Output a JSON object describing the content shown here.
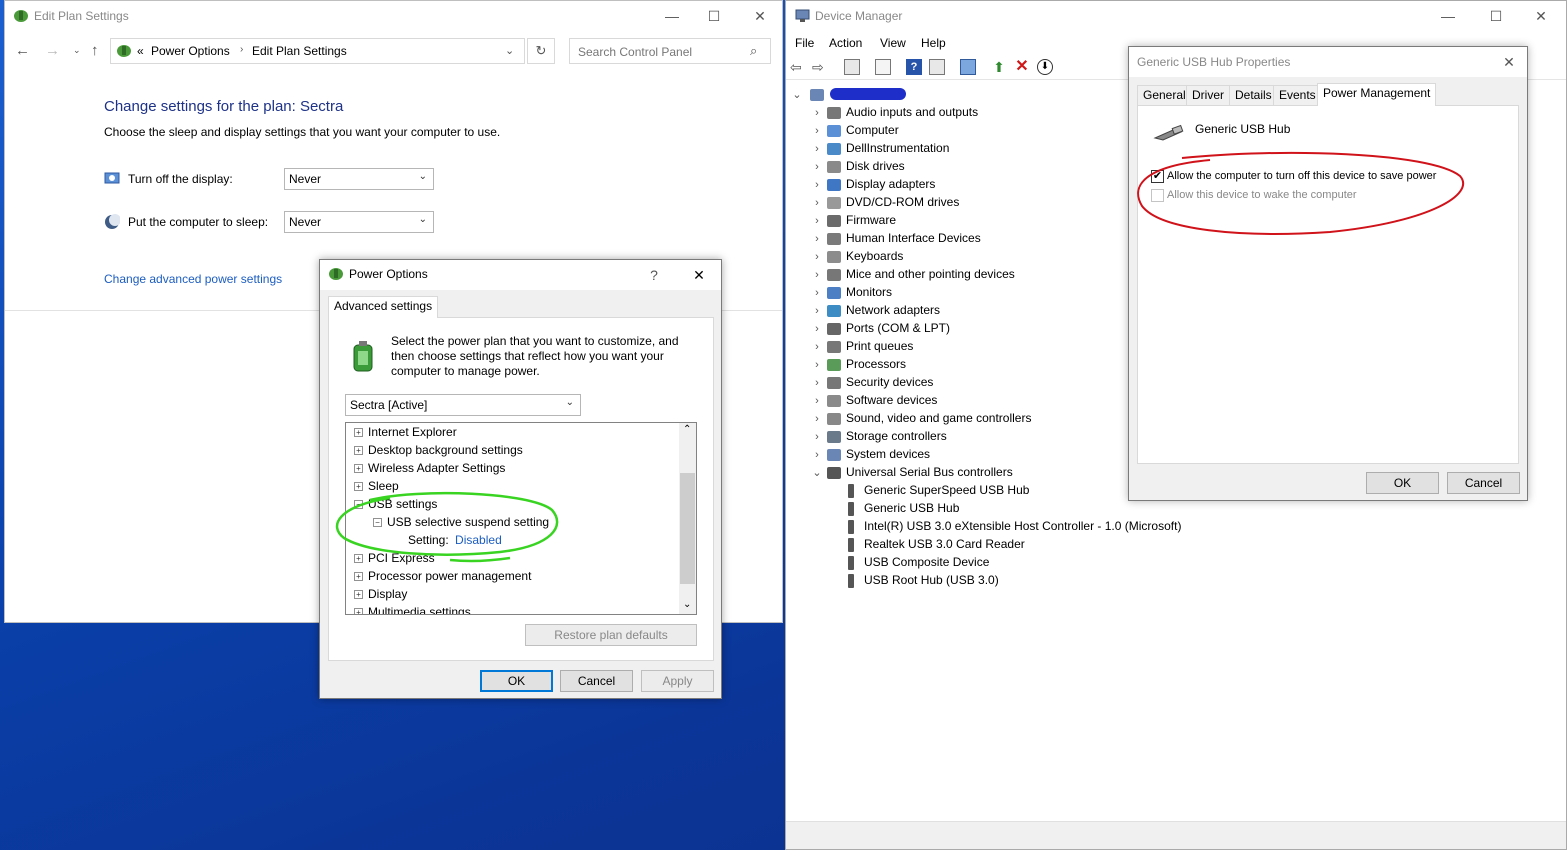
{
  "edit_plan": {
    "title": "Edit Plan Settings",
    "breadcrumb_prefix": "«",
    "breadcrumb": [
      "Power Options",
      "Edit Plan Settings"
    ],
    "search_placeholder": "Search Control Panel",
    "heading": "Change settings for the plan: Sectra",
    "subheading": "Choose the sleep and display settings that you want your computer to use.",
    "display_label": "Turn off the display:",
    "display_value": "Never",
    "sleep_label": "Put the computer to sleep:",
    "sleep_value": "Never",
    "advanced_link": "Change advanced power settings"
  },
  "power_options": {
    "title": "Power Options",
    "help": "?",
    "tab": "Advanced settings",
    "description": "Select the power plan that you want to customize, and then choose settings that reflect how you want your computer to manage power.",
    "plan": "Sectra [Active]",
    "tree": [
      {
        "label": "Internet Explorer",
        "sign": "+"
      },
      {
        "label": "Desktop background settings",
        "sign": "+"
      },
      {
        "label": "Wireless Adapter Settings",
        "sign": "+"
      },
      {
        "label": "Sleep",
        "sign": "+"
      },
      {
        "label": "USB settings",
        "sign": "−"
      },
      {
        "label": "USB selective suspend setting",
        "sign": "−"
      },
      {
        "label": "PCI Express",
        "sign": "+"
      },
      {
        "label": "Processor power management",
        "sign": "+"
      },
      {
        "label": "Display",
        "sign": "+"
      },
      {
        "label": "Multimedia settings",
        "sign": "+"
      }
    ],
    "setting_label": "Setting:",
    "setting_value": "Disabled",
    "restore": "Restore plan defaults",
    "ok": "OK",
    "cancel": "Cancel",
    "apply": "Apply"
  },
  "device_manager": {
    "title": "Device Manager",
    "menu": [
      "File",
      "Action",
      "View",
      "Help"
    ],
    "categories": [
      "Audio inputs and outputs",
      "Computer",
      "DellInstrumentation",
      "Disk drives",
      "Display adapters",
      "DVD/CD-ROM drives",
      "Firmware",
      "Human Interface Devices",
      "Keyboards",
      "Mice and other pointing devices",
      "Monitors",
      "Network adapters",
      "Ports (COM & LPT)",
      "Print queues",
      "Processors",
      "Security devices",
      "Software devices",
      "Sound, video and game controllers",
      "Storage controllers",
      "System devices",
      "Universal Serial Bus controllers"
    ],
    "usb_children": [
      "Generic SuperSpeed USB Hub",
      "Generic USB Hub",
      "Intel(R) USB 3.0 eXtensible Host Controller - 1.0 (Microsoft)",
      "Realtek USB 3.0 Card Reader",
      "USB Composite Device",
      "USB Root Hub (USB 3.0)"
    ]
  },
  "hub_props": {
    "title": "Generic USB Hub Properties",
    "tabs": [
      "General",
      "Driver",
      "Details",
      "Events",
      "Power Management"
    ],
    "device_name": "Generic USB Hub",
    "allow_off": "Allow the computer to turn off this device to save power",
    "allow_off_checked": "✔",
    "allow_wake": "Allow this device to wake the computer",
    "ok": "OK",
    "cancel": "Cancel"
  },
  "colors": {
    "accent": "#0078d7",
    "heading": "#1e3287",
    "link": "#1c5dc1",
    "highlight_green": "#39d322",
    "highlight_red": "#d0121a",
    "redact": "#1d2ec9"
  }
}
